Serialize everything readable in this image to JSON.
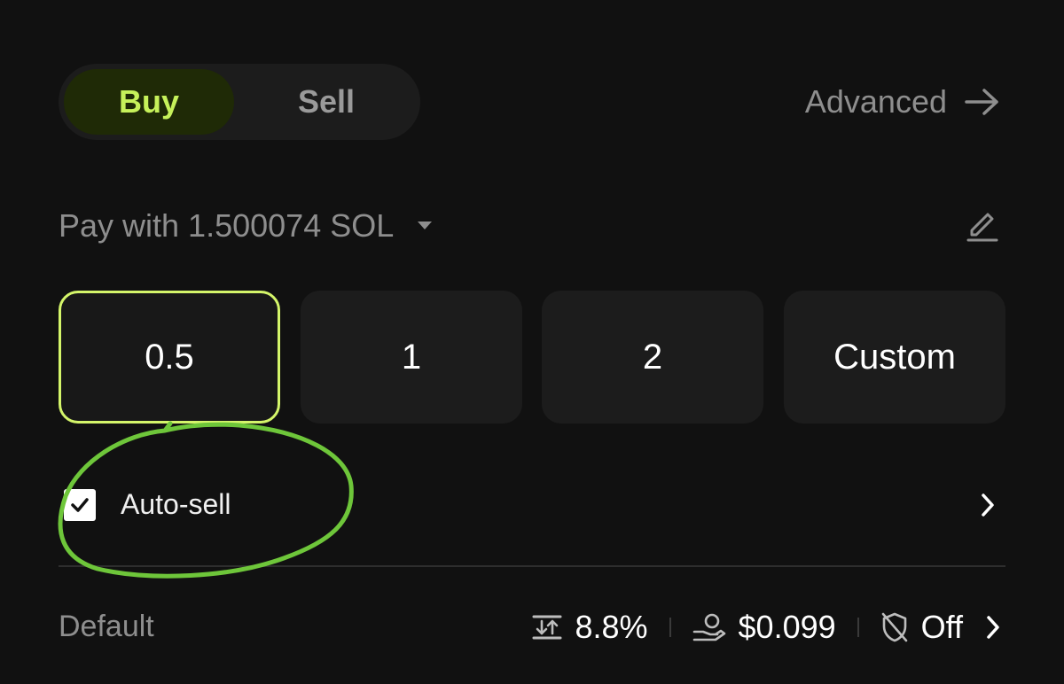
{
  "trade_toggle": {
    "buy_label": "Buy",
    "sell_label": "Sell",
    "selected": "Buy"
  },
  "advanced": {
    "label": "Advanced",
    "icon": "arrow-right-icon"
  },
  "pay_with": {
    "label": "Pay with 1.500074 SOL",
    "icon": "caret-down-icon",
    "edit_icon": "pencil-icon"
  },
  "amounts": {
    "options": [
      "0.5",
      "1",
      "2",
      "Custom"
    ],
    "selected": "0.5"
  },
  "auto_sell": {
    "label": "Auto-sell",
    "checked": true
  },
  "settings": {
    "preset_label": "Default",
    "slippage": "8.8%",
    "priority_fee": "$0.099",
    "mev_protection": "Off"
  },
  "colors": {
    "background": "#111111",
    "accent": "#c6f15a",
    "selected_border": "#d4f56a",
    "annotation": "#6ec63a"
  }
}
